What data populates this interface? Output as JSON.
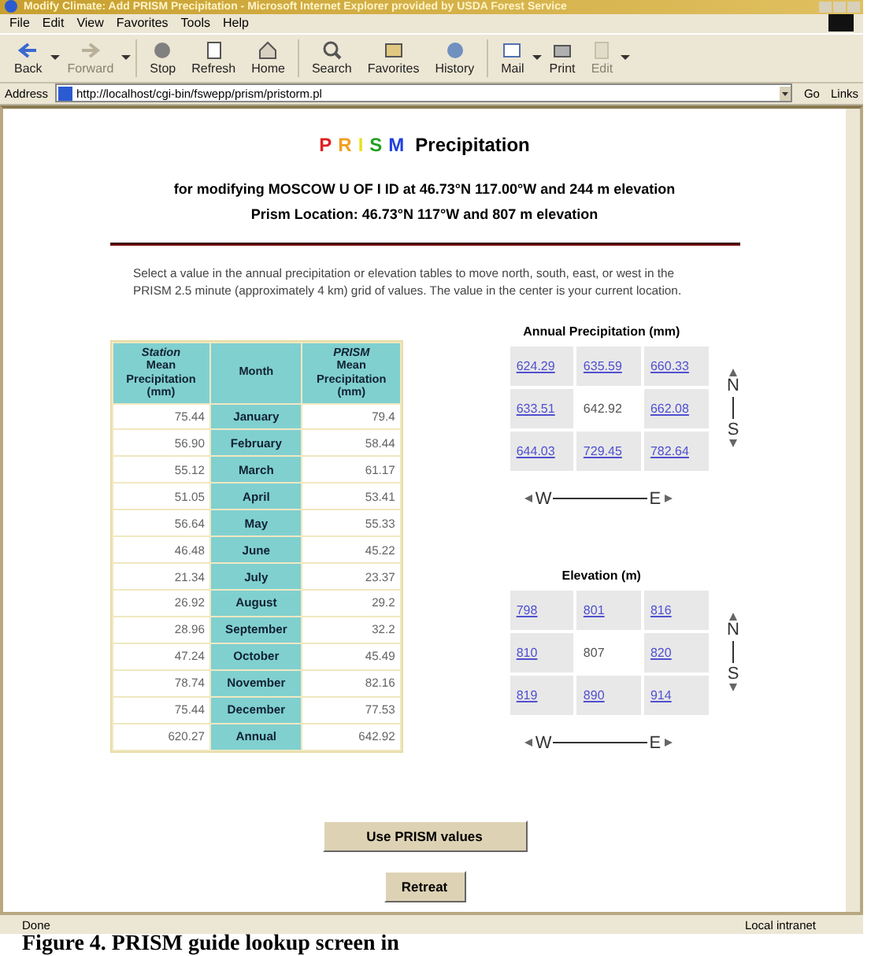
{
  "window": {
    "title": "Modify Climate: Add PRISM Precipitation - Microsoft Internet Explorer provided by USDA Forest Service"
  },
  "menu": [
    "File",
    "Edit",
    "View",
    "Favorites",
    "Tools",
    "Help"
  ],
  "toolbar": [
    {
      "label": "Back",
      "disabled": false,
      "dropdown": true
    },
    {
      "label": "Forward",
      "disabled": true,
      "dropdown": true
    },
    {
      "label": "Stop",
      "disabled": false,
      "dropdown": false
    },
    {
      "label": "Refresh",
      "disabled": false,
      "dropdown": false
    },
    {
      "label": "Home",
      "disabled": false,
      "dropdown": false
    },
    {
      "label": "Search",
      "disabled": false,
      "dropdown": false
    },
    {
      "label": "Favorites",
      "disabled": false,
      "dropdown": false
    },
    {
      "label": "History",
      "disabled": false,
      "dropdown": false
    },
    {
      "label": "Mail",
      "disabled": false,
      "dropdown": true
    },
    {
      "label": "Print",
      "disabled": false,
      "dropdown": false
    },
    {
      "label": "Edit",
      "disabled": true,
      "dropdown": true
    }
  ],
  "address": {
    "label": "Address",
    "value": "http://localhost/cgi-bin/fswepp/prism/pristorm.pl",
    "go": "Go",
    "links": "Links"
  },
  "page": {
    "logo": [
      {
        "letter": "P",
        "color": "#e02020"
      },
      {
        "letter": "R",
        "color": "#f0a020"
      },
      {
        "letter": "I",
        "color": "#e8e020"
      },
      {
        "letter": "S",
        "color": "#20a020"
      },
      {
        "letter": "M",
        "color": "#2040e0"
      }
    ],
    "title": "Precipitation",
    "subtitle": [
      "for modifying MOSCOW U OF I ID at 46.73°N 117.00°W and 244 m elevation",
      "Prism Location: 46.73°N 117°W and 807 m elevation"
    ],
    "instructions": "Select a value in the annual precipitation or elevation tables to move north, south, east, or west in the PRISM 2.5 minute (approximately 4 km) grid of values. The value in the center is your current location.",
    "table": {
      "columns": [
        "*Station*\nMean\nPrecipitation\n(mm)",
        "Month",
        "*PRISM*\nMean\nPrecipitation\n(mm)"
      ],
      "rows": [
        [
          "75.44",
          "January",
          "79.4"
        ],
        [
          "56.90",
          "February",
          "58.44"
        ],
        [
          "55.12",
          "March",
          "61.17"
        ],
        [
          "51.05",
          "April",
          "53.41"
        ],
        [
          "56.64",
          "May",
          "55.33"
        ],
        [
          "46.48",
          "June",
          "45.22"
        ],
        [
          "21.34",
          "July",
          "23.37"
        ],
        [
          "26.92",
          "August",
          "29.2"
        ],
        [
          "28.96",
          "September",
          "32.2"
        ],
        [
          "47.24",
          "October",
          "45.49"
        ],
        [
          "78.74",
          "November",
          "82.16"
        ],
        [
          "75.44",
          "December",
          "77.53"
        ],
        [
          "620.27",
          "Annual",
          "642.92"
        ]
      ]
    },
    "grids": [
      {
        "title": "Annual Precipitation (mm)",
        "cells": [
          [
            {
              "value": "624.29",
              "kind": "link"
            },
            {
              "value": "635.59",
              "kind": "link"
            },
            {
              "value": "660.33",
              "kind": "link"
            }
          ],
          [
            {
              "value": "633.51",
              "kind": "link"
            },
            {
              "value": "642.92",
              "kind": "current"
            },
            {
              "value": "662.08",
              "kind": "link"
            }
          ],
          [
            {
              "value": "644.03",
              "kind": "link"
            },
            {
              "value": "729.45",
              "kind": "link"
            },
            {
              "value": "782.64",
              "kind": "link"
            }
          ]
        ],
        "north": "N",
        "south": "S",
        "west": "W",
        "east": "E"
      },
      {
        "title": "Elevation (m)",
        "cells": [
          [
            {
              "value": "798",
              "kind": "link"
            },
            {
              "value": "801",
              "kind": "link"
            },
            {
              "value": "816",
              "kind": "link"
            }
          ],
          [
            {
              "value": "810",
              "kind": "link"
            },
            {
              "value": "807",
              "kind": "current"
            },
            {
              "value": "820",
              "kind": "link"
            }
          ],
          [
            {
              "value": "819",
              "kind": "link"
            },
            {
              "value": "890",
              "kind": "link"
            },
            {
              "value": "914",
              "kind": "link"
            }
          ]
        ],
        "north": "N",
        "south": "S",
        "west": "W",
        "east": "E"
      }
    ],
    "buttons": [
      "Use PRISM values",
      "Retreat"
    ]
  },
  "status": {
    "text": "Done",
    "zone": "Local intranet"
  },
  "caption": "Figure 4. PRISM guide lookup screen in"
}
